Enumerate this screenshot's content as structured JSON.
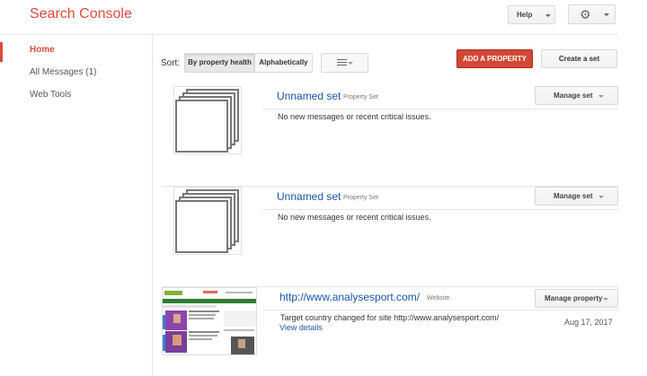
{
  "header": {
    "app_title": "Search Console",
    "help_label": "Help",
    "settings_icon": "gear-icon"
  },
  "sidebar": {
    "items": [
      {
        "label": "Home",
        "active": true
      },
      {
        "label": "All Messages (1)",
        "active": false
      },
      {
        "label": "Web Tools",
        "active": false
      }
    ]
  },
  "toolbar": {
    "sort_label": "Sort:",
    "sort_options": [
      "By property health",
      "Alphabetically"
    ],
    "sort_selected": "By property health",
    "view_icon": "list-view-icon",
    "add_property_label": "ADD A PROPERTY",
    "create_set_label": "Create a set"
  },
  "properties": [
    {
      "kind": "set",
      "title": "Unnamed set",
      "type": "Property Set",
      "message": "No new messages or recent critical issues.",
      "manage_label": "Manage set"
    },
    {
      "kind": "set",
      "title": "Unnamed set",
      "type": "Property Set",
      "message": "No new messages or recent critical issues.",
      "manage_label": "Manage set"
    },
    {
      "kind": "site",
      "title": "http://www.analysesport.com/",
      "type": "Website",
      "message": "Target country changed for site http://www.analysesport.com/",
      "link_label": "View details",
      "date": "Aug 17, 2017",
      "manage_label": "Manage property"
    }
  ],
  "colors": {
    "brand": "#dd4b39",
    "primary_button": "#d14836",
    "link": "#1a55a8"
  }
}
